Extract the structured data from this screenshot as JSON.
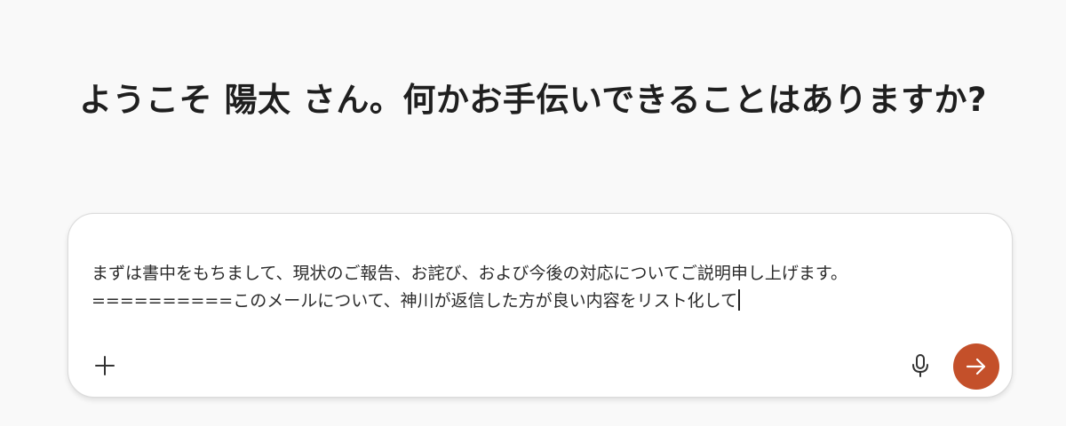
{
  "greeting": "ようこそ 陽太 さん。何かお手伝いできることはありますか?",
  "composer": {
    "line1": "まずは書中をもちまして、現状のご報告、お詫び、および今後の対応についてご説明申し上げます。",
    "line2": "==========このメールについて、神川が返信した方が良い内容をリスト化して"
  },
  "icons": {
    "add": "plus-icon",
    "mic": "microphone-icon",
    "send": "arrow-right-icon"
  },
  "colors": {
    "background": "#f9f9f9",
    "send_button": "#c4502a",
    "text": "#1f1f1f"
  }
}
